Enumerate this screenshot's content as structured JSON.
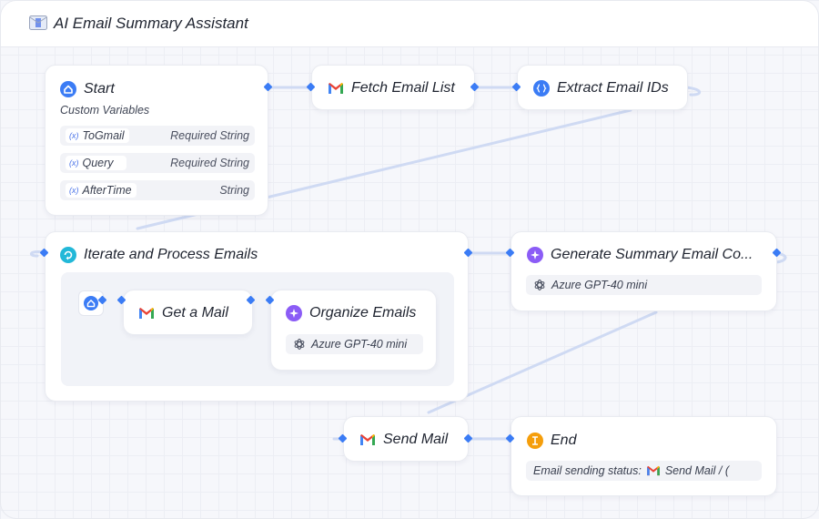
{
  "app": {
    "title": "AI Email Summary Assistant",
    "icon": "envelope-icon"
  },
  "nodes": {
    "start": {
      "title": "Start",
      "subtitle": "Custom Variables",
      "variables": [
        {
          "name": "ToGmail",
          "type": "Required String"
        },
        {
          "name": "Query",
          "type": "Required String"
        },
        {
          "name": "AfterTime",
          "type": "String"
        }
      ],
      "var_badge": "(x)"
    },
    "fetch": {
      "title": "Fetch Email List",
      "icon": "gmail-icon"
    },
    "extract": {
      "title": "Extract Email IDs",
      "icon": "code-braces-icon"
    },
    "iterate": {
      "title": "Iterate and Process Emails",
      "icon": "loop-icon",
      "children": {
        "get_mail": {
          "title": "Get a Mail",
          "icon": "gmail-icon"
        },
        "organize": {
          "title": "Organize Emails",
          "model": "Azure GPT-40 mini",
          "icon": "sparkle-icon"
        }
      }
    },
    "generate": {
      "title": "Generate Summary Email Co...",
      "model": "Azure GPT-40 mini",
      "icon": "sparkle-icon"
    },
    "send": {
      "title": "Send Mail",
      "icon": "gmail-icon"
    },
    "end": {
      "title": "End",
      "status_label": "Email sending status:",
      "status_ref": "Send Mail / (",
      "icon": "end-icon"
    }
  },
  "colors": {
    "accent": "#3b7cf5",
    "purple": "#8b5cf6",
    "orange": "#f59e0b",
    "cyan": "#22b8d8"
  }
}
